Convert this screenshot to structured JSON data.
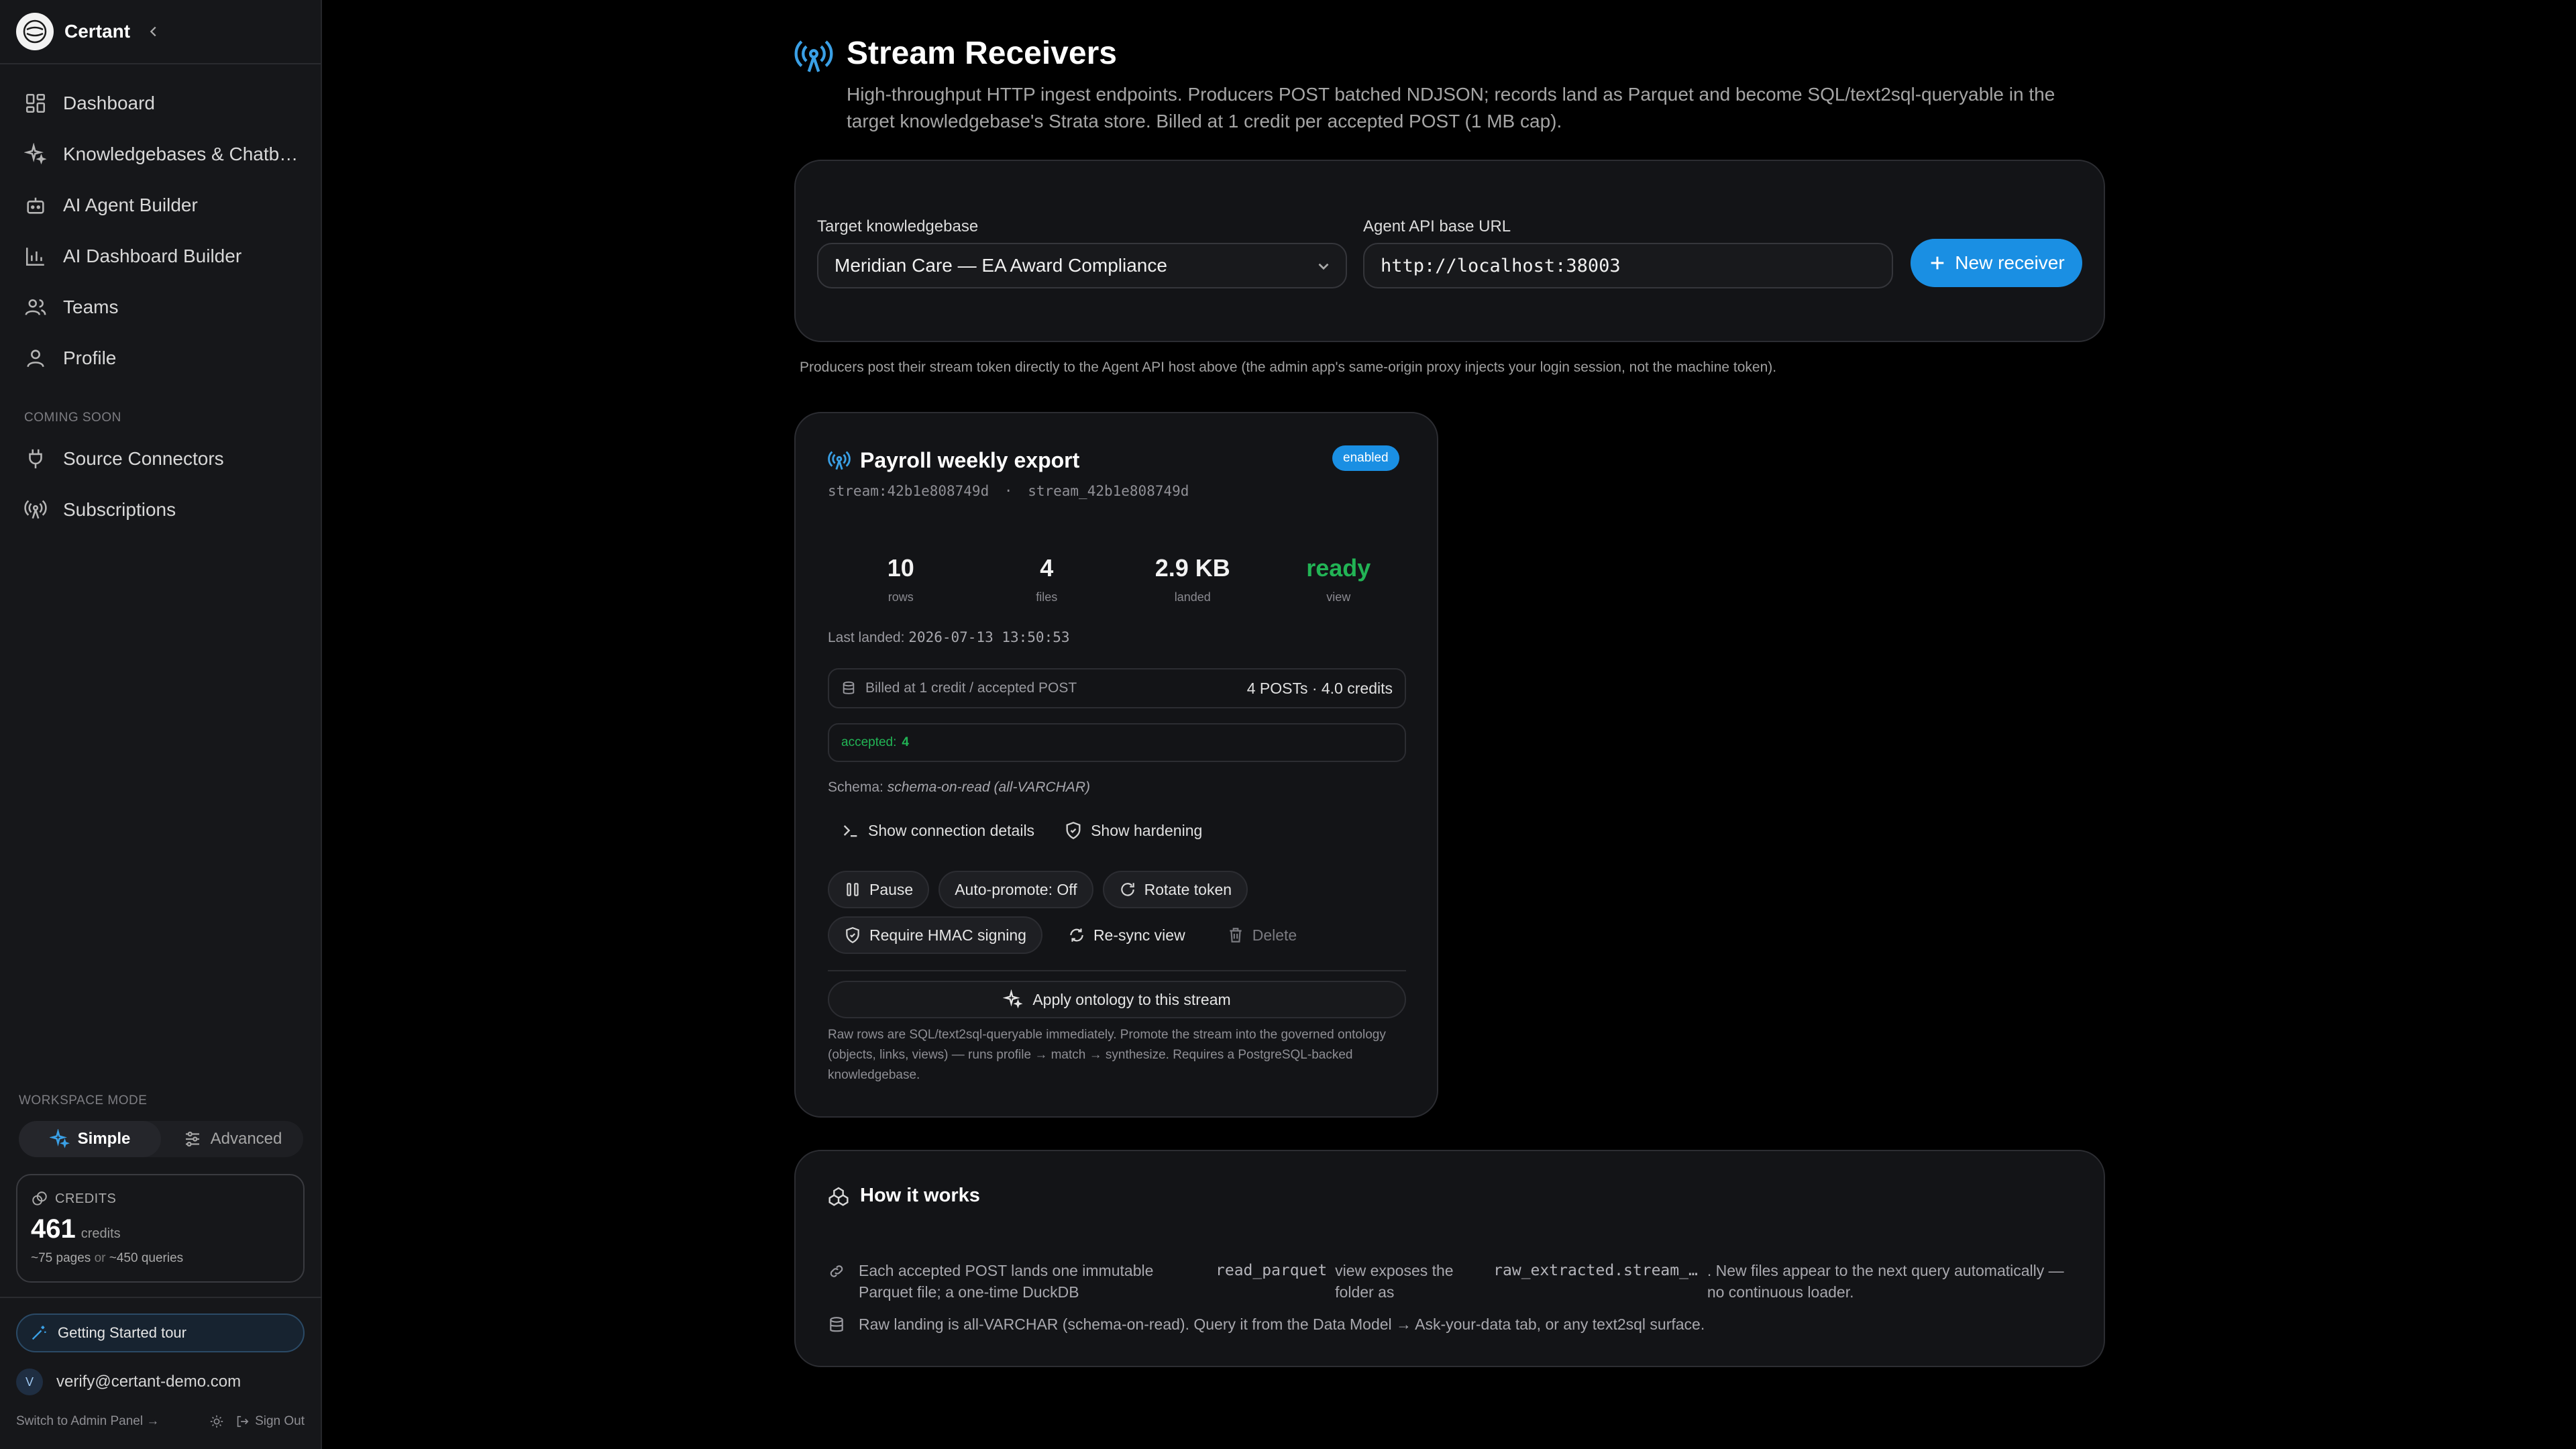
{
  "sidebar": {
    "brand": "Certant",
    "nav": [
      {
        "label": "Dashboard",
        "icon": "dashboard-icon"
      },
      {
        "label": "Knowledgebases & Chatb…",
        "icon": "sparkle-icon"
      },
      {
        "label": "AI Agent Builder",
        "icon": "robot-icon"
      },
      {
        "label": "AI Dashboard Builder",
        "icon": "bar-chart-icon"
      },
      {
        "label": "Teams",
        "icon": "users-icon"
      },
      {
        "label": "Profile",
        "icon": "user-icon"
      }
    ],
    "coming_soon_label": "COMING SOON",
    "coming_soon": [
      {
        "label": "Source Connectors",
        "icon": "plug-icon"
      },
      {
        "label": "Subscriptions",
        "icon": "broadcast-icon"
      }
    ],
    "workspace_mode_label": "WORKSPACE MODE",
    "mode_simple": "Simple",
    "mode_advanced": "Advanced",
    "credits": {
      "label": "CREDITS",
      "value": "461",
      "unit": "credits",
      "pages": "~75 pages",
      "or": "or",
      "queries": "~450 queries"
    },
    "tour_label": "Getting Started tour",
    "user_initial": "V",
    "user_email": "verify@certant-demo.com",
    "admin_link": "Switch to Admin Panel →",
    "sign_out": "Sign Out"
  },
  "page": {
    "title": "Stream Receivers",
    "description": "High-throughput HTTP ingest endpoints. Producers POST batched NDJSON; records land as Parquet and become SQL/text2sql-queryable in the target knowledgebase's Strata store. Billed at 1 credit per accepted POST (1 MB cap)."
  },
  "filters": {
    "kb_label": "Target knowledgebase",
    "kb_value": "Meridian Care — EA Award Compliance",
    "api_label": "Agent API base URL",
    "api_value": "http://localhost:38003",
    "new_button": "New receiver"
  },
  "proxy_note": "Producers post their stream token directly to the Agent API host above (the admin app's same-origin proxy injects your login session, not the machine token).",
  "receiver": {
    "title": "Payroll weekly export",
    "status": "enabled",
    "stream_id": "stream:42b1e808749d",
    "separator": "·",
    "table_name": "stream_42b1e808749d",
    "stats": [
      {
        "value": "10",
        "label": "rows"
      },
      {
        "value": "4",
        "label": "files"
      },
      {
        "value": "2.9 KB",
        "label": "landed"
      },
      {
        "value": "ready",
        "label": "view"
      }
    ],
    "last_landed_label": "Last landed:",
    "last_landed_value": "2026-07-13 13:50:53",
    "billing_label": "Billed at 1 credit / accepted POST",
    "billing_value": "4 POSTs · 4.0 credits",
    "accepted_label": "accepted:",
    "accepted_value": "4",
    "schema_label": "Schema:",
    "schema_value": "schema-on-read (all-VARCHAR)",
    "show_connection": "Show connection details",
    "show_hardening": "Show hardening",
    "pause": "Pause",
    "auto_promote": "Auto-promote: Off",
    "rotate_token": "Rotate token",
    "require_hmac": "Require HMAC signing",
    "resync": "Re-sync view",
    "delete": "Delete",
    "apply_ontology": "Apply ontology to this stream",
    "ontology_note": "Raw rows are SQL/text2sql-queryable immediately. Promote the stream into the governed ontology (objects, links, views) — runs profile → match → synthesize. Requires a PostgreSQL-backed knowledgebase."
  },
  "how": {
    "title": "How it works",
    "row1_a": "Each accepted POST lands one immutable Parquet file; a one-time DuckDB",
    "row1_code1": "read_parquet",
    "row1_b": "view exposes the folder as",
    "row1_code2": "raw_extracted.stream_…",
    "row1_c": ". New files appear to the next query automatically — no continuous loader.",
    "row2": "Raw landing is all-VARCHAR (schema-on-read). Query it from the Data Model → Ask-your-data tab, or any text2sql surface."
  }
}
